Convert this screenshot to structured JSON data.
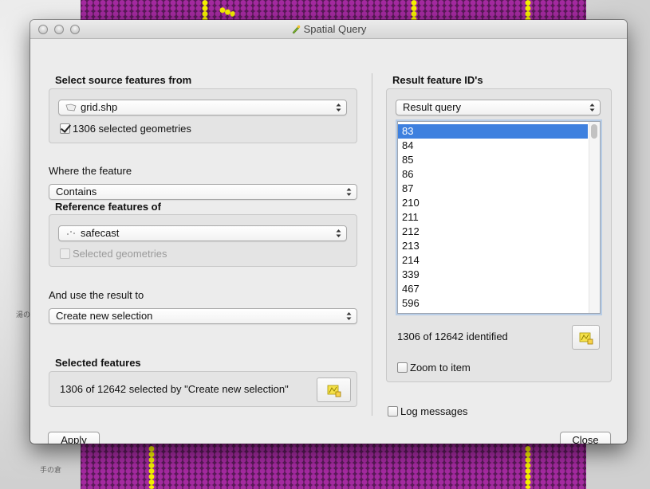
{
  "map": {
    "labels": [
      "湯の",
      "手の倉"
    ]
  },
  "window": {
    "title": "Spatial Query"
  },
  "left": {
    "source_heading": "Select source features from",
    "source_layer": "grid.shp",
    "source_selected_label": "1306 selected geometries",
    "source_selected_checked": true,
    "where_label": "Where the feature",
    "operator": "Contains",
    "reference_heading": "Reference features of",
    "reference_layer": "safecast",
    "reference_selected_label": "Selected geometries",
    "reference_selected_checked": false,
    "use_result_label": "And use the result to",
    "result_action": "Create new selection",
    "selected_heading": "Selected features",
    "selected_summary": "1306 of 12642 selected by \"Create new selection\""
  },
  "right": {
    "heading": "Result feature ID's",
    "query_combo": "Result query",
    "ids": [
      "83",
      "84",
      "85",
      "86",
      "87",
      "210",
      "211",
      "212",
      "213",
      "214",
      "339",
      "467",
      "596"
    ],
    "selected_id_index": 0,
    "identified_summary": "1306 of 12642 identified",
    "zoom_label": "Zoom to item",
    "zoom_checked": false
  },
  "bottom": {
    "log_label": "Log messages",
    "log_checked": false,
    "apply_label": "Apply",
    "close_label": "Close"
  },
  "colors": {
    "selection_blue": "#3d80df",
    "grid_purple": "#a42aa0",
    "highlight_yellow": "#f4f000"
  }
}
